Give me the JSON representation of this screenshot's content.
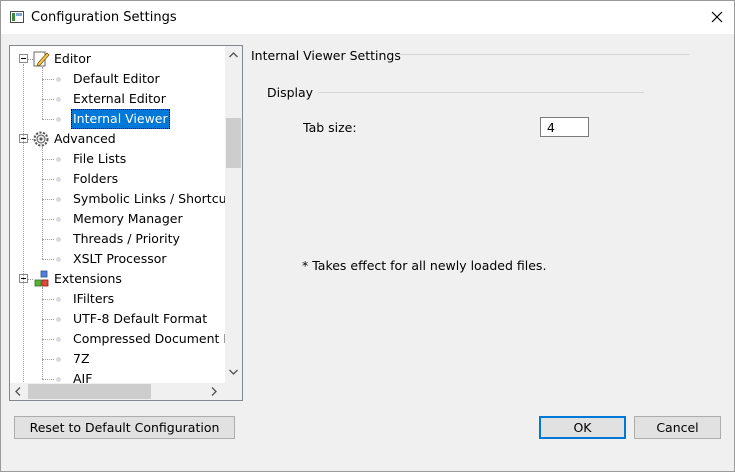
{
  "window": {
    "title": "Configuration Settings"
  },
  "tree": {
    "items": [
      {
        "label": "Editor",
        "level": 0,
        "expanded": true,
        "icon": "editor-pencil-icon"
      },
      {
        "label": "Default Editor",
        "level": 1
      },
      {
        "label": "External Editor",
        "level": 1
      },
      {
        "label": "Internal Viewer",
        "level": 1,
        "selected": true
      },
      {
        "label": "Advanced",
        "level": 0,
        "expanded": true,
        "icon": "gear-icon"
      },
      {
        "label": "File Lists",
        "level": 1
      },
      {
        "label": "Folders",
        "level": 1
      },
      {
        "label": "Symbolic Links / Shortcut",
        "level": 1
      },
      {
        "label": "Memory Manager",
        "level": 1
      },
      {
        "label": "Threads / Priority",
        "level": 1
      },
      {
        "label": "XSLT Processor",
        "level": 1
      },
      {
        "label": "Extensions",
        "level": 0,
        "expanded": true,
        "icon": "extensions-blocks-icon"
      },
      {
        "label": "IFilters",
        "level": 1
      },
      {
        "label": "UTF-8 Default Format",
        "level": 1
      },
      {
        "label": "Compressed Document R",
        "level": 1
      },
      {
        "label": "7Z",
        "level": 1
      },
      {
        "label": "AIF",
        "level": 1
      }
    ]
  },
  "settings": {
    "section_title": "Internal Viewer Settings",
    "display_group": "Display",
    "tab_size_label": "Tab size:",
    "tab_size_value": "4",
    "note": "* Takes effect for all newly loaded files."
  },
  "buttons": {
    "reset": "Reset to Default Configuration",
    "ok": "OK",
    "cancel": "Cancel"
  },
  "colors": {
    "selection": "#0078d7",
    "default_button_border": "#0078d7"
  }
}
